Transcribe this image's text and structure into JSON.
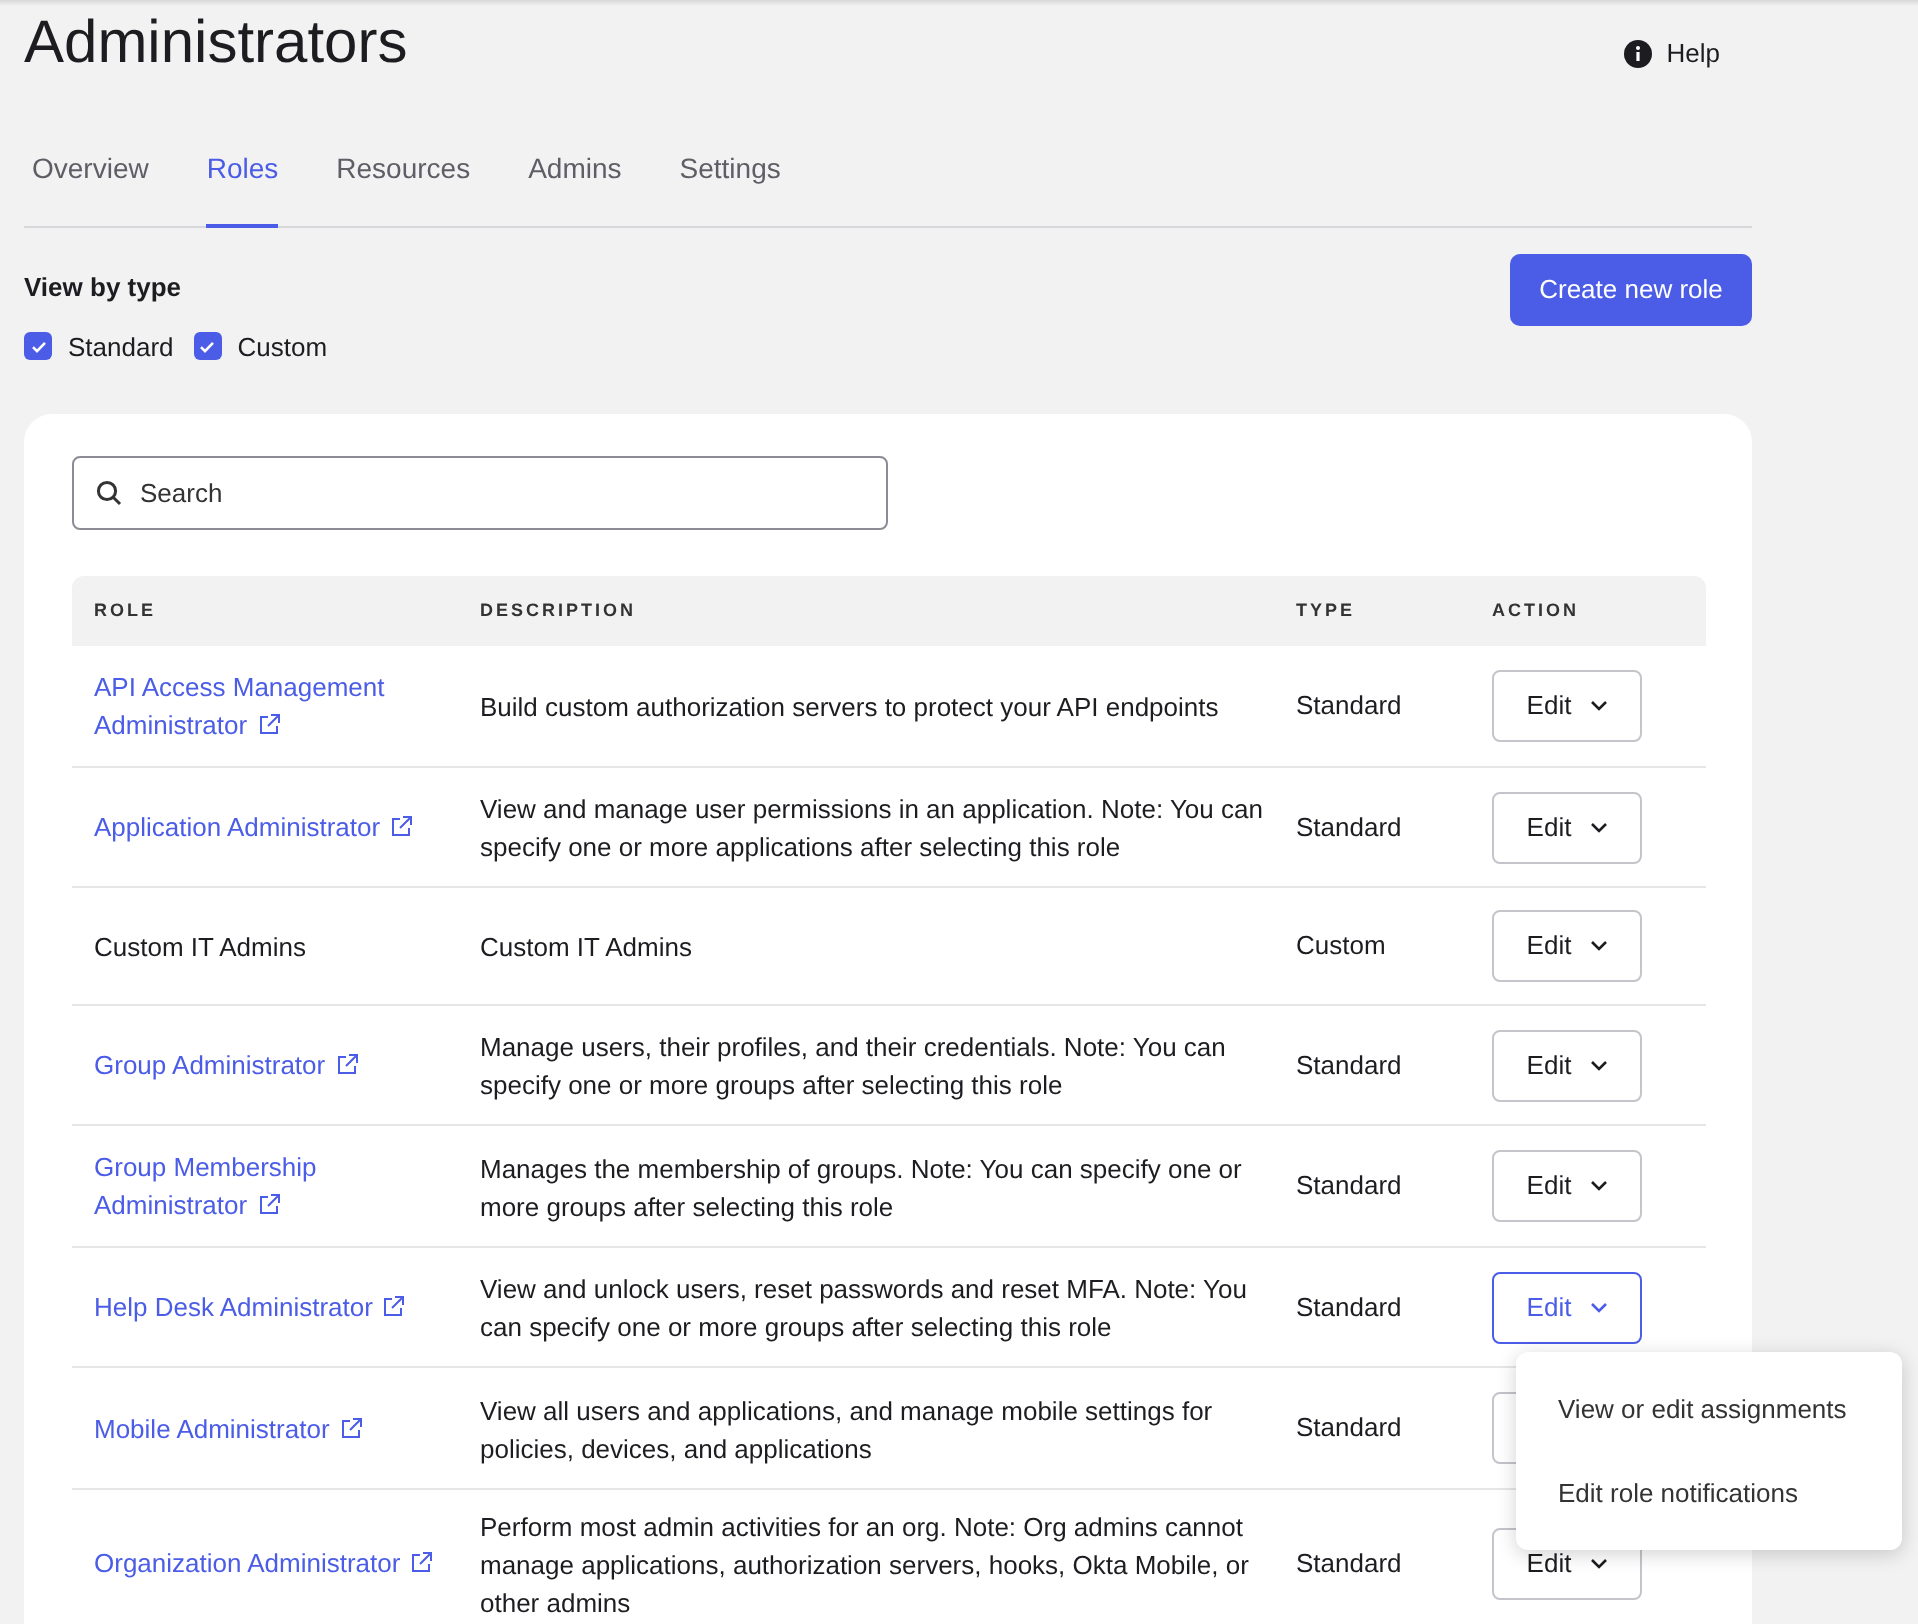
{
  "page_title": "Administrators",
  "help": {
    "label": "Help"
  },
  "tabs": [
    {
      "label": "Overview",
      "selected": false
    },
    {
      "label": "Roles",
      "selected": true
    },
    {
      "label": "Resources",
      "selected": false
    },
    {
      "label": "Admins",
      "selected": false
    },
    {
      "label": "Settings",
      "selected": false
    }
  ],
  "filter": {
    "label": "View by type",
    "options": [
      {
        "label": "Standard",
        "checked": true
      },
      {
        "label": "Custom",
        "checked": true
      }
    ]
  },
  "create_button": "Create new role",
  "search": {
    "placeholder": "Search"
  },
  "table": {
    "columns": [
      "ROLE",
      "DESCRIPTION",
      "TYPE",
      "ACTION"
    ],
    "rows": [
      {
        "role": "API Access Management Administrator",
        "linked": true,
        "description": "Build custom authorization servers to protect your API endpoints",
        "type": "Standard",
        "action": "Edit",
        "open": false
      },
      {
        "role": "Application Administrator",
        "linked": true,
        "description": "View and manage user permissions in an application. Note: You can specify one or more applications after selecting this role",
        "type": "Standard",
        "action": "Edit",
        "open": false
      },
      {
        "role": "Custom IT Admins",
        "linked": false,
        "description": "Custom IT Admins",
        "type": "Custom",
        "action": "Edit",
        "open": false
      },
      {
        "role": "Group Administrator",
        "linked": true,
        "description": "Manage users, their profiles, and their credentials. Note: You can specify one or more groups after selecting this role",
        "type": "Standard",
        "action": "Edit",
        "open": false
      },
      {
        "role": "Group Membership Administrator",
        "linked": true,
        "description": "Manages the membership of groups. Note: You can specify one or more groups after selecting this role",
        "type": "Standard",
        "action": "Edit",
        "open": false
      },
      {
        "role": "Help Desk Administrator",
        "linked": true,
        "description": "View and unlock users, reset passwords and reset MFA. Note: You can specify one or more groups after selecting this role",
        "type": "Standard",
        "action": "Edit",
        "open": true
      },
      {
        "role": "Mobile Administrator",
        "linked": true,
        "description": "View all users and applications, and manage mobile settings for policies, devices, and applications",
        "type": "Standard",
        "open": false
      },
      {
        "role": "Organization Administrator",
        "linked": true,
        "description": "Perform most admin activities for an org. Note: Org admins cannot manage applications, authorization servers, hooks, Okta Mobile, or other admins",
        "type": "Standard",
        "action": "Edit",
        "open": false
      }
    ]
  },
  "menu": {
    "items": [
      "View or edit assignments",
      "Edit role notifications"
    ]
  }
}
